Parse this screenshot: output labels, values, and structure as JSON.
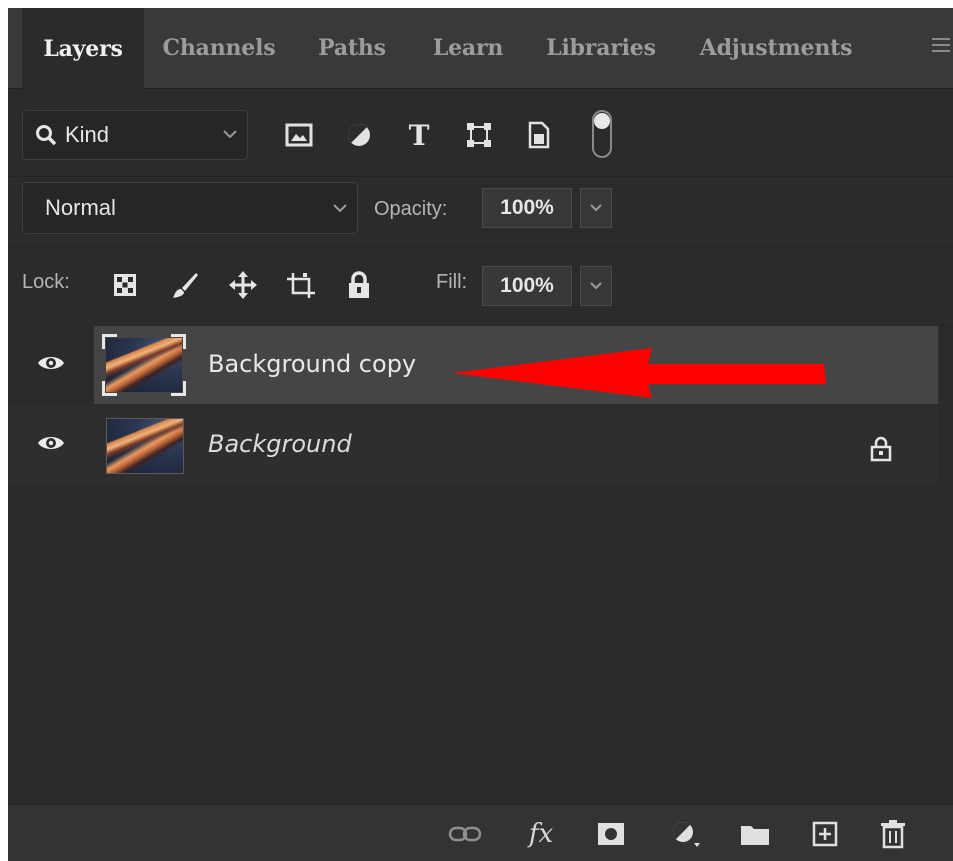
{
  "tabs": [
    {
      "label": "Layers",
      "active": true
    },
    {
      "label": "Channels",
      "active": false
    },
    {
      "label": "Paths",
      "active": false
    },
    {
      "label": "Learn",
      "active": false
    },
    {
      "label": "Libraries",
      "active": false
    },
    {
      "label": "Adjustments",
      "active": false
    }
  ],
  "filter": {
    "kind_label": "Kind",
    "icons": [
      "image-filter-icon",
      "adjustment-filter-icon",
      "type-filter-icon",
      "shape-filter-icon",
      "smart-object-filter-icon",
      "filter-toggle-icon"
    ],
    "type_glyph": "T"
  },
  "blend": {
    "mode": "Normal",
    "opacity_label": "Opacity:",
    "opacity_value": "100%"
  },
  "lock": {
    "label": "Lock:",
    "icons": [
      "lock-transparent-pixels-icon",
      "lock-image-pixels-icon",
      "lock-position-icon",
      "lock-artboard-icon",
      "lock-all-icon"
    ],
    "fill_label": "Fill:",
    "fill_value": "100%"
  },
  "layers": [
    {
      "name": "Background copy",
      "selected": true,
      "visible": true,
      "locked": false
    },
    {
      "name": "Background",
      "selected": false,
      "visible": true,
      "locked": true
    }
  ],
  "annotation": {
    "arrow_color": "#ff0000"
  },
  "bottom_toolbar": {
    "fx_label": "fx",
    "icons": [
      "link-layers-icon",
      "fx-icon",
      "add-mask-icon",
      "new-adjustment-layer-icon",
      "new-group-icon",
      "new-layer-icon",
      "delete-layer-icon"
    ]
  },
  "colors": {
    "panel_bg": "#2b2b2b",
    "tab_bar_bg": "#393939",
    "selected_layer_bg": "#454545"
  }
}
